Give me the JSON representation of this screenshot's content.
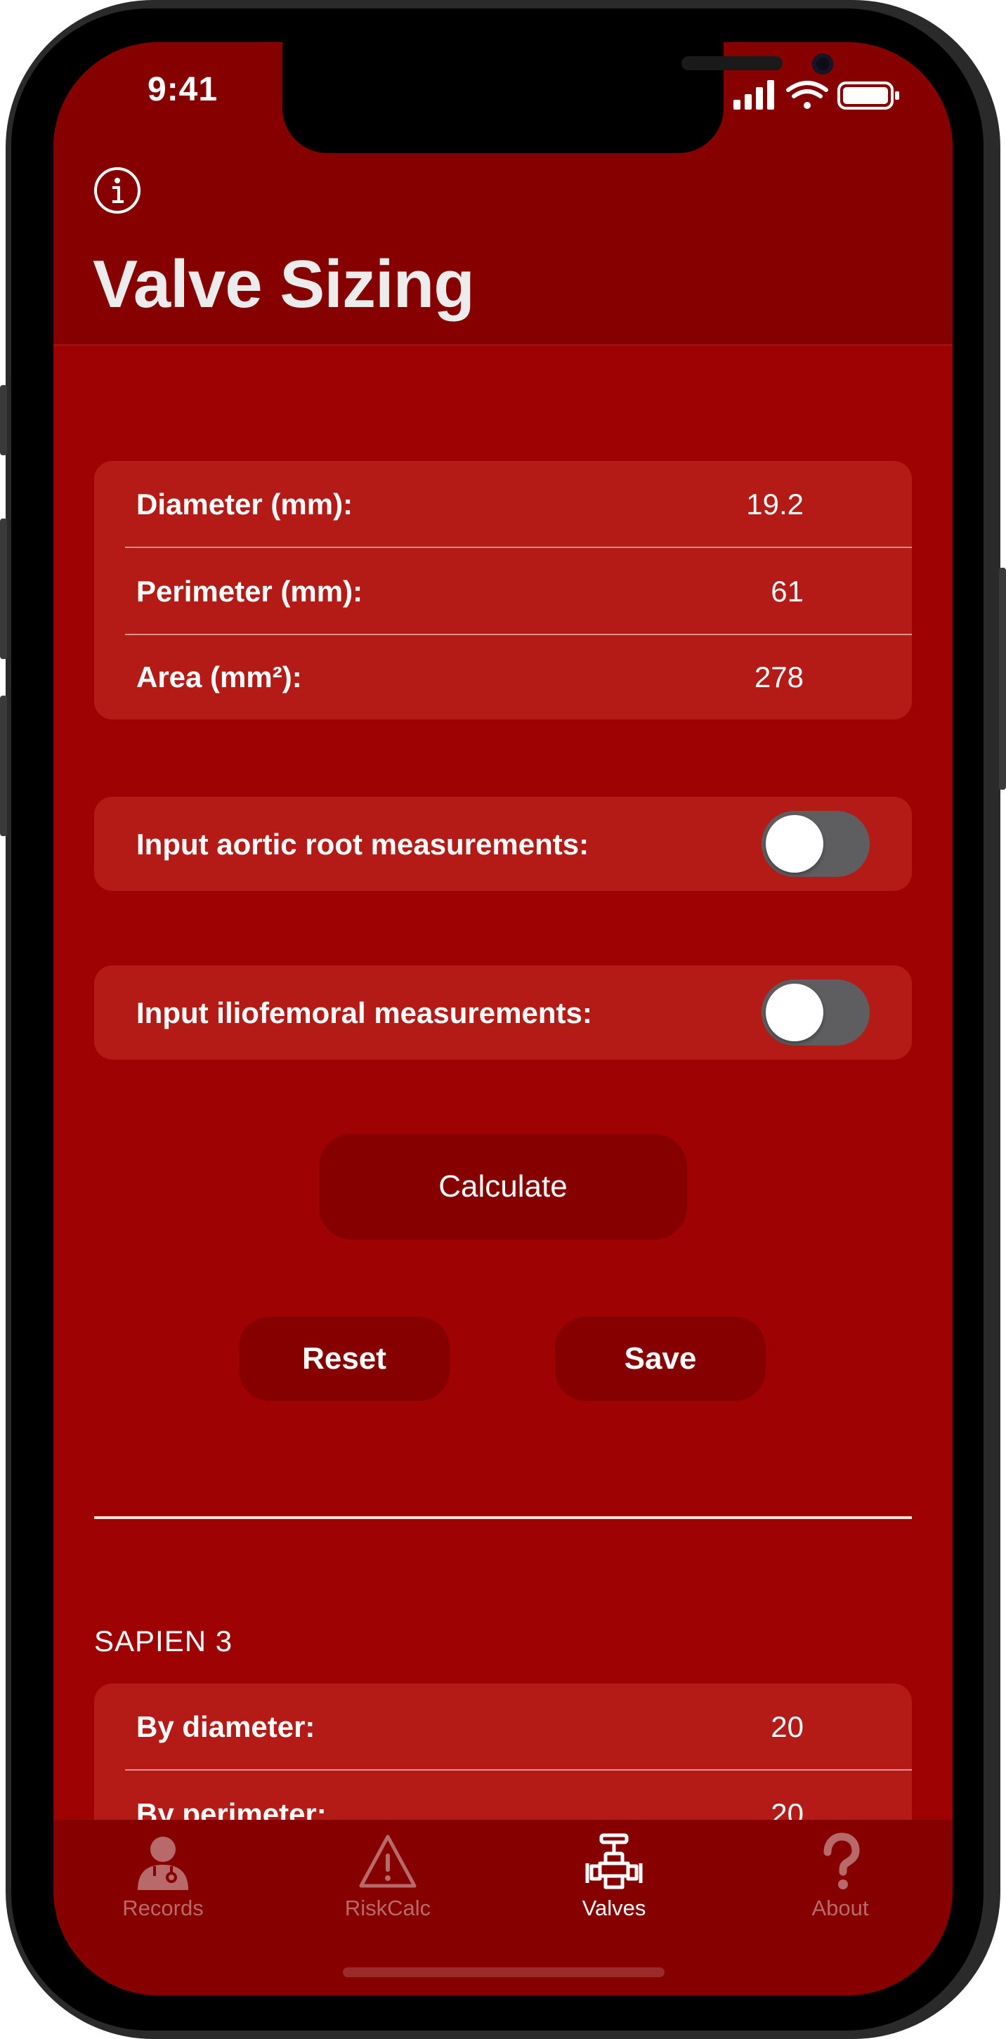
{
  "status_bar": {
    "time": "9:41"
  },
  "header": {
    "title": "Valve Sizing"
  },
  "measurements": {
    "rows": [
      {
        "label": "Diameter (mm):",
        "value": "19.2"
      },
      {
        "label": "Perimeter (mm):",
        "value": "61"
      },
      {
        "label": "Area (mm²):",
        "value": "278"
      }
    ]
  },
  "options": {
    "aortic_root": {
      "label": "Input aortic root measurements:",
      "enabled": false
    },
    "iliofemoral": {
      "label": "Input iliofemoral measurements:",
      "enabled": false
    }
  },
  "actions": {
    "calculate": "Calculate",
    "reset": "Reset",
    "save": "Save"
  },
  "results": {
    "section_title": "SAPIEN 3",
    "rows": [
      {
        "label": "By diameter:",
        "value": "20"
      },
      {
        "label": "By perimeter:",
        "value": "20"
      }
    ]
  },
  "tabbar": {
    "tabs": [
      {
        "label": "Records",
        "icon": "doctor-icon",
        "active": false
      },
      {
        "label": "RiskCalc",
        "icon": "warning-icon",
        "active": false
      },
      {
        "label": "Valves",
        "icon": "valve-icon",
        "active": true
      },
      {
        "label": "About",
        "icon": "question-icon",
        "active": false
      }
    ]
  },
  "colors": {
    "header_bg": "#870000",
    "screen_bg": "#9e0202",
    "card_bg": "#b51b16",
    "button_bg": "#870000",
    "toggle_off": "#5e5e60",
    "tab_inactive": "#b86a6a",
    "tab_active": "#ffffff"
  }
}
